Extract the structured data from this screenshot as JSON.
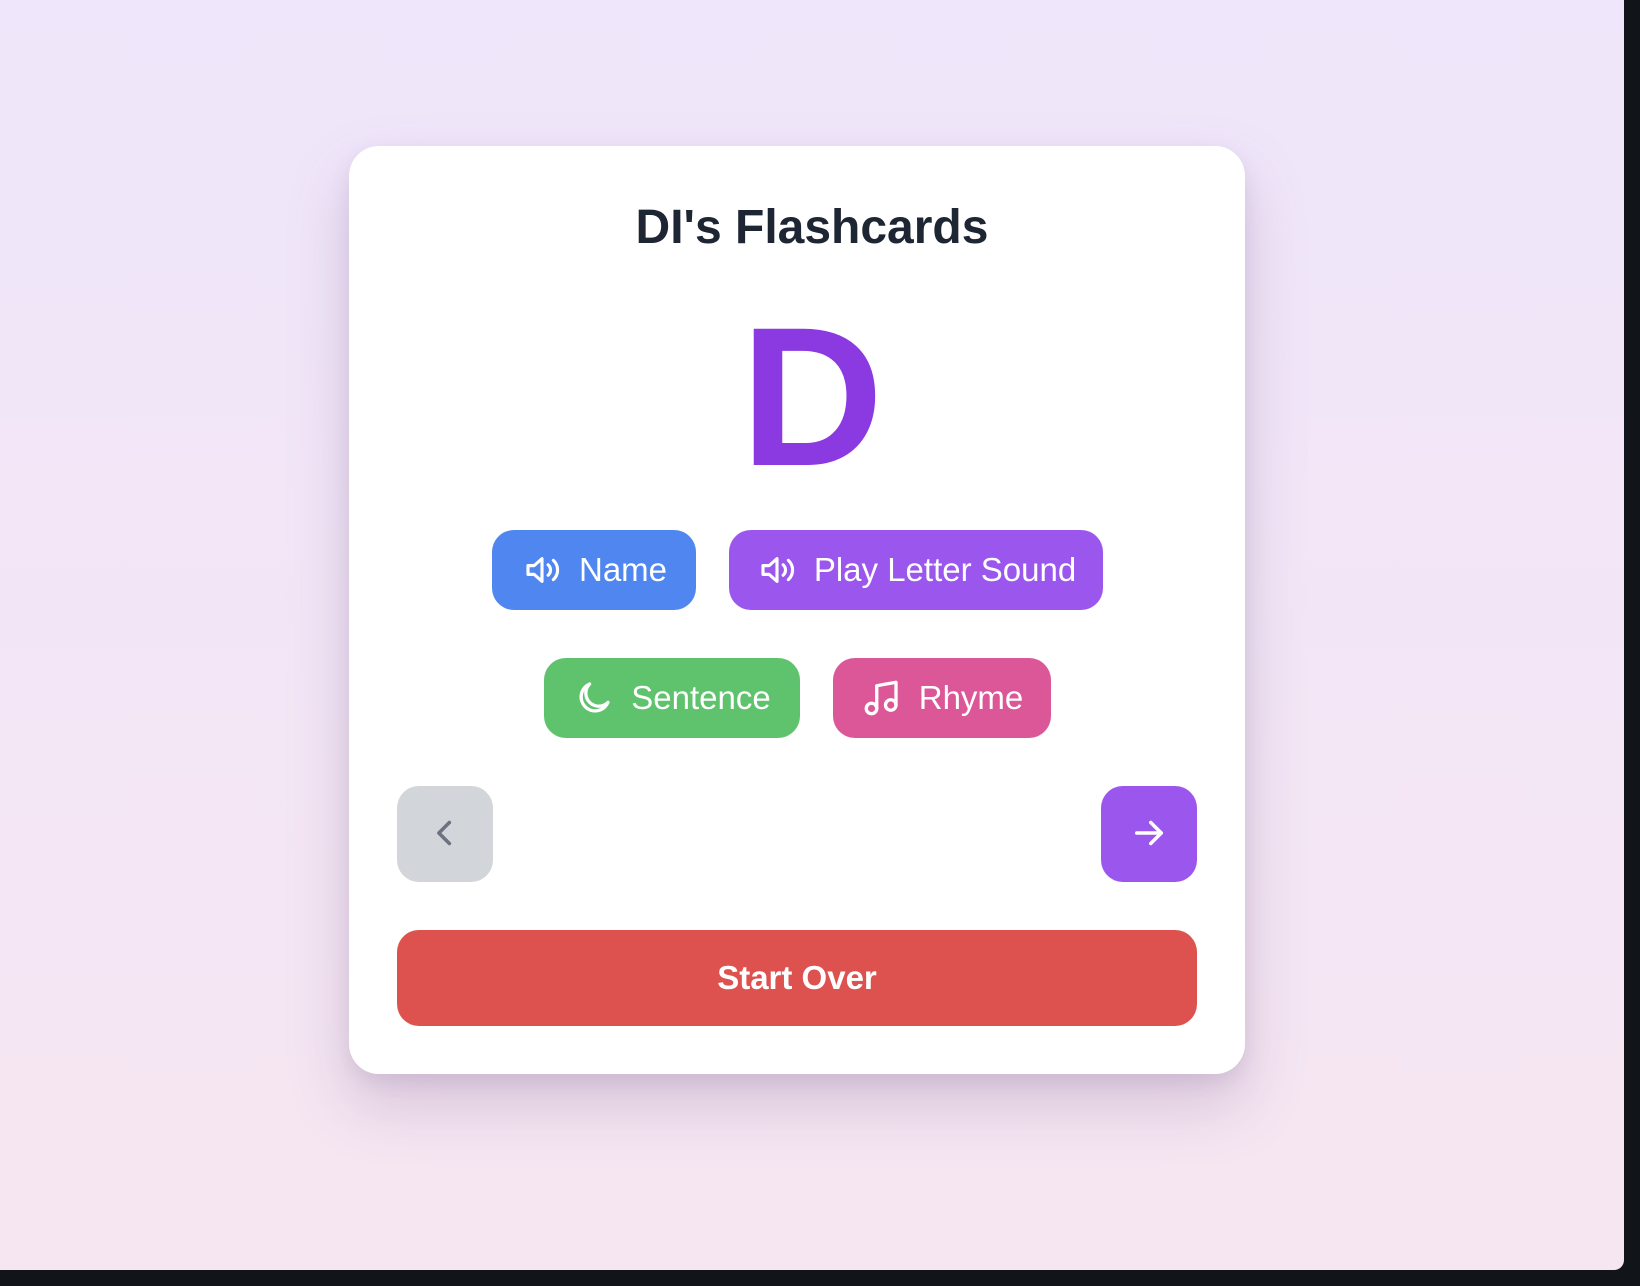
{
  "app": {
    "title": "DI's Flashcards"
  },
  "card": {
    "letter": "D"
  },
  "buttons": {
    "name": {
      "label": "Name",
      "icon": "speaker-icon",
      "color": "#4f86ef"
    },
    "sound": {
      "label": "Play Letter Sound",
      "icon": "speaker-icon",
      "color": "#9b56ee"
    },
    "sentence": {
      "label": "Sentence",
      "icon": "moon-icon",
      "color": "#5fc26c"
    },
    "rhyme": {
      "label": "Rhyme",
      "icon": "music-note-icon",
      "color": "#dc5797"
    }
  },
  "navigation": {
    "prev_icon": "chevron-left-icon",
    "next_icon": "arrow-right-icon",
    "prev_color": "#d2d5da",
    "next_color": "#9b56ee"
  },
  "start_over": {
    "label": "Start Over",
    "color": "#dd524f"
  },
  "colors": {
    "letter": "#8a3ae0",
    "title": "#1e2533"
  }
}
